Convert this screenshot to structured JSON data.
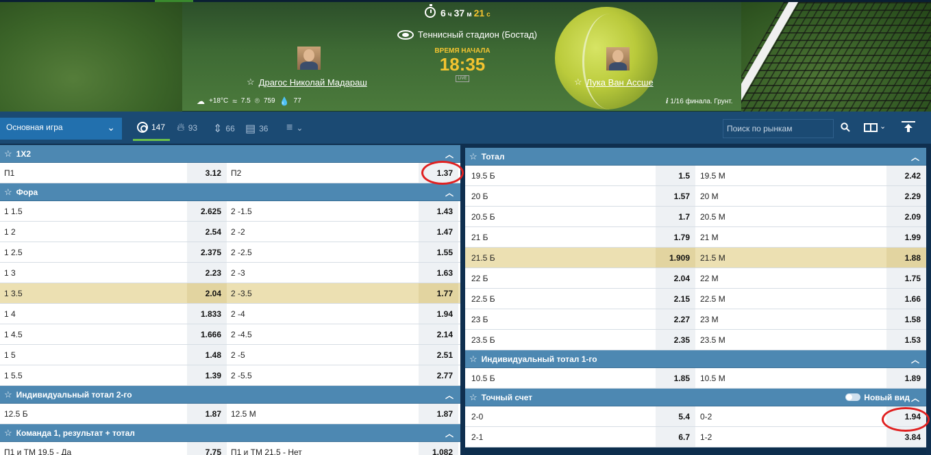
{
  "countdown": {
    "hours": "6",
    "hours_unit": "ч",
    "minutes": "37",
    "minutes_unit": "м",
    "seconds": "21",
    "seconds_unit": "с"
  },
  "venue": "Теннисный стадион (Бостад)",
  "start": {
    "label": "ВРЕМЯ НАЧАЛА",
    "time": "18:35",
    "live": "LIVE"
  },
  "players": {
    "p1": "Драгос Николай Мадараш",
    "p2": "Лука Ван Ассше"
  },
  "weather": {
    "temp": "+18°C",
    "wind": "7.5",
    "pressure": "759",
    "humidity": "77"
  },
  "round": {
    "icon": "i",
    "text": "1/16 финала. Грунт."
  },
  "toolbar": {
    "game_select": "Основная игра",
    "tabs": [
      {
        "count": "147",
        "icon": "target-icon"
      },
      {
        "count": "93",
        "icon": "fire-icon"
      },
      {
        "count": "66",
        "icon": "updown-icon"
      },
      {
        "count": "36",
        "icon": "stats-icon"
      }
    ],
    "search_placeholder": "Поиск по рынкам"
  },
  "left_markets": [
    {
      "title": "1X2",
      "rows": [
        {
          "a": "П1",
          "ao": "3.12",
          "b": "П2",
          "bo": "1.37"
        }
      ]
    },
    {
      "title": "Фора",
      "rows": [
        {
          "a": "1 1.5",
          "ao": "2.625",
          "b": "2 -1.5",
          "bo": "1.43"
        },
        {
          "a": "1 2",
          "ao": "2.54",
          "b": "2 -2",
          "bo": "1.47"
        },
        {
          "a": "1 2.5",
          "ao": "2.375",
          "b": "2 -2.5",
          "bo": "1.55"
        },
        {
          "a": "1 3",
          "ao": "2.23",
          "b": "2 -3",
          "bo": "1.63"
        },
        {
          "a": "1 3.5",
          "ao": "2.04",
          "b": "2 -3.5",
          "bo": "1.77",
          "hl": true
        },
        {
          "a": "1 4",
          "ao": "1.833",
          "b": "2 -4",
          "bo": "1.94"
        },
        {
          "a": "1 4.5",
          "ao": "1.666",
          "b": "2 -4.5",
          "bo": "2.14"
        },
        {
          "a": "1 5",
          "ao": "1.48",
          "b": "2 -5",
          "bo": "2.51"
        },
        {
          "a": "1 5.5",
          "ao": "1.39",
          "b": "2 -5.5",
          "bo": "2.77"
        }
      ]
    },
    {
      "title": "Индивидуальный тотал 2-го",
      "rows": [
        {
          "a": "12.5 Б",
          "ao": "1.87",
          "b": "12.5 М",
          "bo": "1.87"
        }
      ]
    },
    {
      "title": "Команда 1, результат + тотал",
      "rows": [
        {
          "a": "П1 и ТМ 19.5 - Да",
          "ao": "7.75",
          "b": "П1 и ТМ 21.5 - Нет",
          "bo": "1.082"
        }
      ]
    }
  ],
  "right_markets": [
    {
      "title": "Тотал",
      "rows": [
        {
          "a": "19.5 Б",
          "ao": "1.5",
          "b": "19.5 М",
          "bo": "2.42"
        },
        {
          "a": "20 Б",
          "ao": "1.57",
          "b": "20 М",
          "bo": "2.29"
        },
        {
          "a": "20.5 Б",
          "ao": "1.7",
          "b": "20.5 М",
          "bo": "2.09"
        },
        {
          "a": "21 Б",
          "ao": "1.79",
          "b": "21 М",
          "bo": "1.99"
        },
        {
          "a": "21.5 Б",
          "ao": "1.909",
          "b": "21.5 М",
          "bo": "1.88",
          "hl": true
        },
        {
          "a": "22 Б",
          "ao": "2.04",
          "b": "22 М",
          "bo": "1.75"
        },
        {
          "a": "22.5 Б",
          "ao": "2.15",
          "b": "22.5 М",
          "bo": "1.66"
        },
        {
          "a": "23 Б",
          "ao": "2.27",
          "b": "23 М",
          "bo": "1.58"
        },
        {
          "a": "23.5 Б",
          "ao": "2.35",
          "b": "23.5 М",
          "bo": "1.53"
        }
      ]
    },
    {
      "title": "Индивидуальный тотал 1-го",
      "rows": [
        {
          "a": "10.5 Б",
          "ao": "1.85",
          "b": "10.5 М",
          "bo": "1.89"
        }
      ]
    },
    {
      "title": "Точный счет",
      "new_view": "Новый вид",
      "rows": [
        {
          "a": "2-0",
          "ao": "5.4",
          "b": "0-2",
          "bo": "1.94"
        },
        {
          "a": "2-1",
          "ao": "6.7",
          "b": "1-2",
          "bo": "3.84"
        }
      ]
    }
  ],
  "colors": {
    "header_blue": "#4d88b2",
    "toolbar": "#1b4a73",
    "select": "#2270ae",
    "highlight_row": "#ece0b2",
    "accent_time": "#f4c430",
    "annotation": "#e02020"
  }
}
